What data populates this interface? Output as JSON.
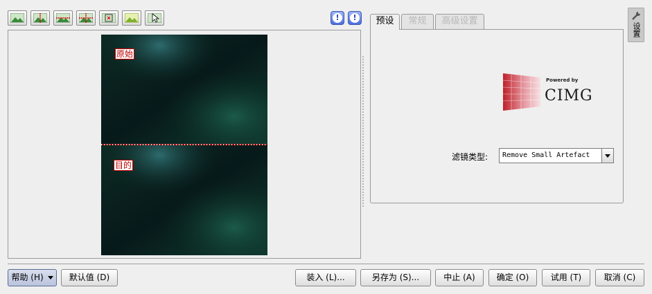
{
  "toolbar": {
    "buttons": [
      {
        "name": "original-preview-button",
        "icon": "image-icon"
      },
      {
        "name": "split-vertical-button",
        "icon": "split-vertical-icon"
      },
      {
        "name": "split-horizontal-button",
        "icon": "split-horizontal-icon"
      },
      {
        "name": "split-both-button",
        "icon": "split-both-icon"
      },
      {
        "name": "compare-button",
        "icon": "compare-icon"
      },
      {
        "name": "target-preview-button",
        "icon": "image-icon"
      },
      {
        "name": "select-point-button",
        "icon": "cursor-icon"
      }
    ],
    "info_icons": [
      "underexposure-indicator-icon",
      "overexposure-indicator-icon"
    ]
  },
  "preview": {
    "original_label": "原始",
    "target_label": "目的"
  },
  "tabs": [
    {
      "label": "预设",
      "active": true
    },
    {
      "label": "常规",
      "active": false
    },
    {
      "label": "高级设置",
      "active": false
    }
  ],
  "logo": {
    "powered_by": "Powered by",
    "brand": "CIMG"
  },
  "filter": {
    "label": "滤镜类型:",
    "value": "Remove Small Artefact"
  },
  "side_tab": {
    "label": "设置"
  },
  "buttons": {
    "help": "帮助 (H)",
    "defaults": "默认值 (D)",
    "load": "装入 (L)...",
    "save_as": "另存为 (S)...",
    "abort": "中止 (A)",
    "ok": "确定 (O)",
    "try": "试用 (T)",
    "cancel": "取消 (C)"
  },
  "colors": {
    "accent": "#3a55b0",
    "label_red": "#c00000",
    "preview_dark": "#0a241c"
  }
}
